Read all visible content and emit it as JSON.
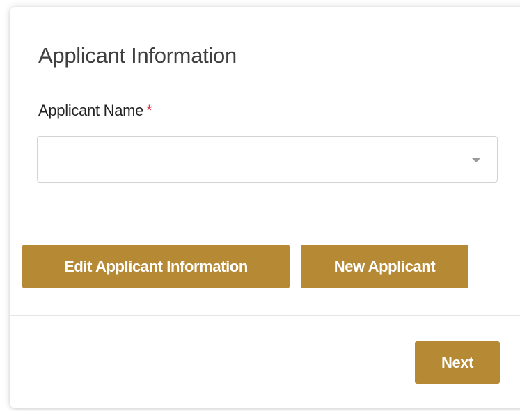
{
  "section": {
    "title": "Applicant Information"
  },
  "applicant_field": {
    "label": "Applicant Name",
    "required_mark": "*",
    "value": ""
  },
  "actions": {
    "edit_label": "Edit Applicant Information",
    "new_label": "New Applicant"
  },
  "footer": {
    "next_label": "Next"
  },
  "icons": {
    "dropdown": "caret-down-icon"
  },
  "colors": {
    "accent": "#b68a35",
    "required": "#e0303a",
    "title_text": "#3f3f3f"
  }
}
